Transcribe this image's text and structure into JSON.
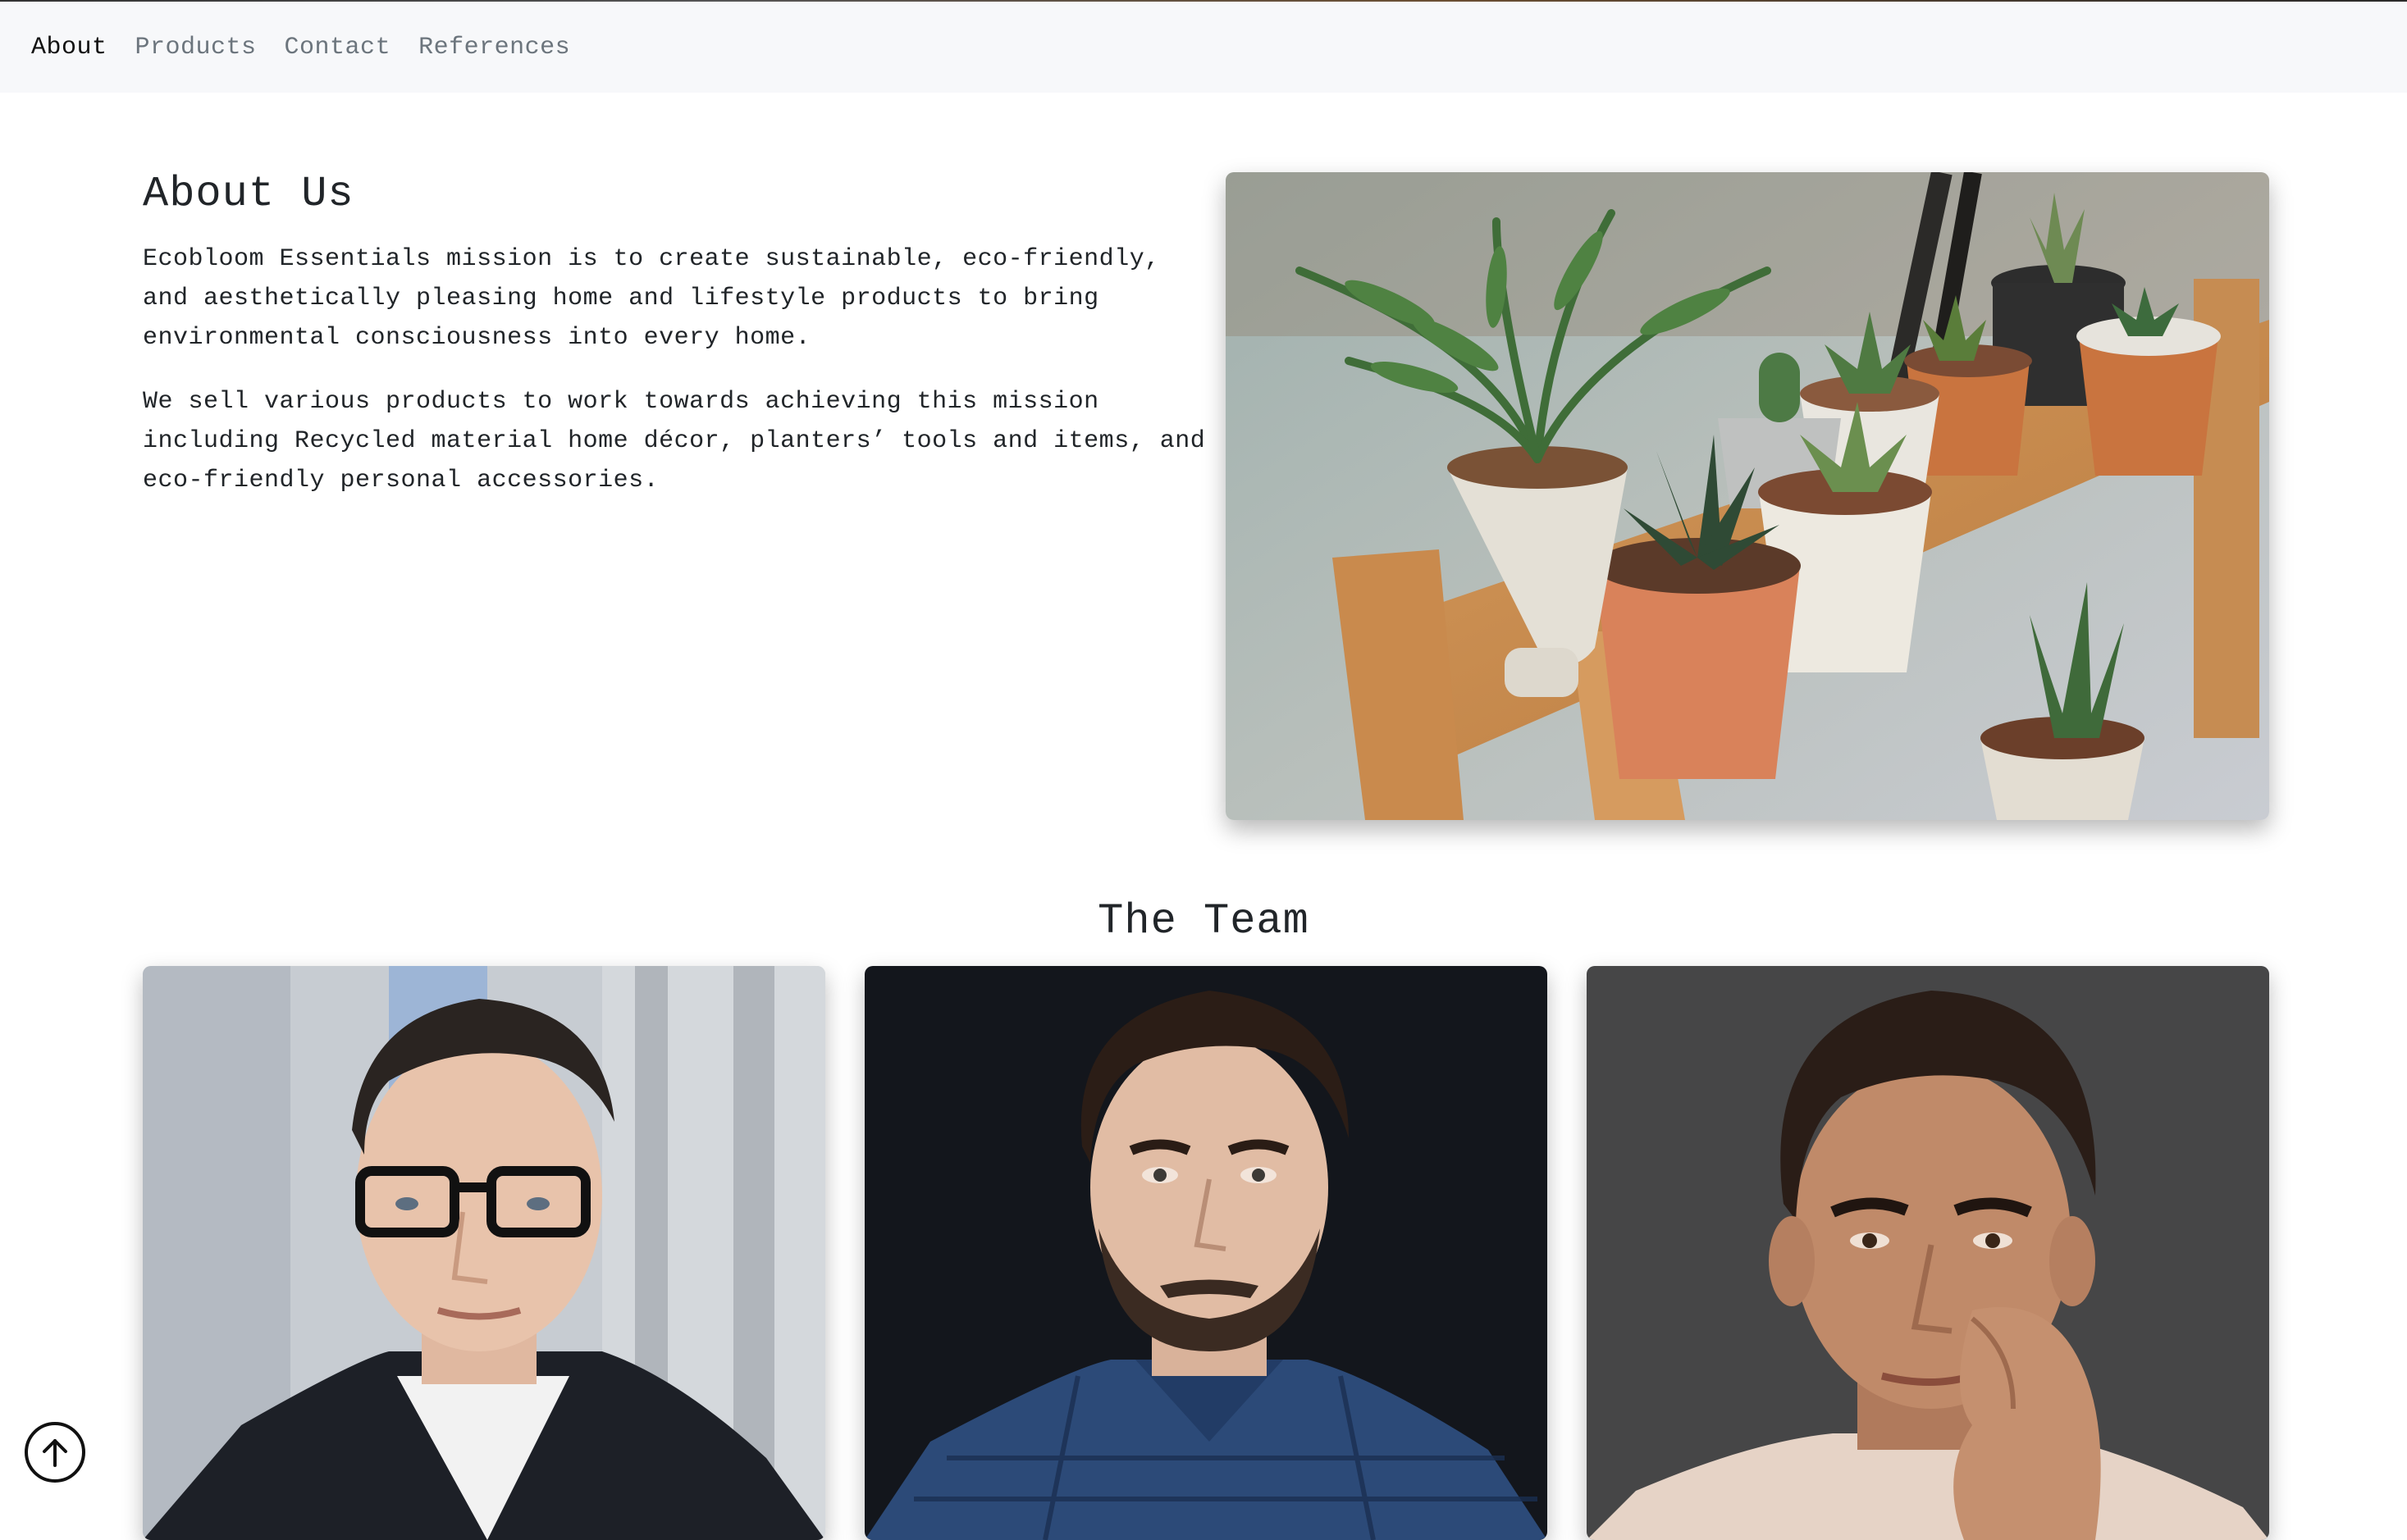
{
  "nav": {
    "items": [
      {
        "label": "About",
        "active": true
      },
      {
        "label": "Products",
        "active": false
      },
      {
        "label": "Contact",
        "active": false
      },
      {
        "label": "References",
        "active": false
      }
    ]
  },
  "about": {
    "title": "About Us",
    "paragraph1": "Ecobloom Essentials mission is to create sustainable, eco-friendly, and aesthetically pleasing home and lifestyle products to bring environmental consciousness into every home.",
    "paragraph2": "We sell various products to work towards achieving this mission including Recycled material home décor, planters’ tools and items, and eco-friendly personal accessories."
  },
  "team": {
    "title": "The Team"
  },
  "icons": {
    "scroll_top": "arrow-up-circle-icon"
  }
}
